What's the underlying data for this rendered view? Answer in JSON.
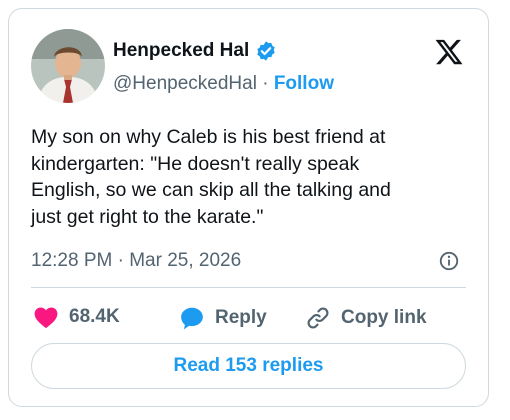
{
  "author": {
    "display_name": "Henpecked Hal",
    "handle": "@HenpeckedHal",
    "separator": "·",
    "follow_label": "Follow",
    "verified": true
  },
  "tweet": {
    "text": "My son on why Caleb is his best friend at\nkindergarten: \"He doesn't really speak\nEnglish, so we can skip all the talking and\njust get right to the karate.\"",
    "timestamp": "12:28 PM · Mar 25, 2026"
  },
  "actions": {
    "likes_count": "68.4K",
    "reply_label": "Reply",
    "copy_link_label": "Copy link"
  },
  "read_replies_label": "Read 153 replies",
  "colors": {
    "accent": "#1d9bf0",
    "like": "#f91880",
    "secondary_text": "#536471",
    "border": "#cfd9de"
  },
  "icons": {
    "verified": "verified-badge-icon",
    "platform": "x-logo-icon",
    "info": "info-icon",
    "like": "heart-icon",
    "reply": "speech-bubble-icon",
    "copy": "link-icon"
  }
}
